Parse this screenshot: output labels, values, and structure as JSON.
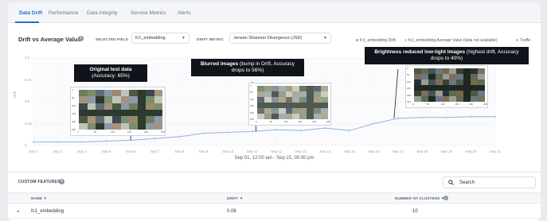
{
  "tabs": [
    {
      "label": "Data Drift",
      "active": true
    },
    {
      "label": "Performance",
      "active": false
    },
    {
      "label": "Data Integrity",
      "active": false
    },
    {
      "label": "Service Metrics",
      "active": false
    },
    {
      "label": "Alerts",
      "active": false
    }
  ],
  "chart_header": {
    "title": "Drift vs Average Value",
    "selected_field_label": "SELECTED FIELD",
    "selected_field_value": "fc1_embedding",
    "drift_metric_label": "DRIFT METRIC",
    "drift_metric_value": "Jensen Shannon Divergence (JSD)",
    "legend": [
      {
        "label": "fc1_embedding Drift",
        "color": "#7ea7dd"
      },
      {
        "label": "fc1_embedding Average Value (data not available)",
        "color": "#c9ced6"
      },
      {
        "label": "Traffic",
        "color": "#c7b4e6"
      }
    ]
  },
  "chart_data": {
    "type": "line",
    "ylabel": "Drift",
    "y_ticks": [
      "1.0",
      "0.75",
      "0.5",
      "0.25",
      "0"
    ],
    "ylim": [
      0,
      1
    ],
    "x_ticks": [
      "Sep 1",
      "Sep 3",
      "Sep 4",
      "Sep 5",
      "Sep 6",
      "Sep 7",
      "Sep 8",
      "Sep 9",
      "Sep 10",
      "Sep 11",
      "Sep 12",
      "Sep 13",
      "Sep 14",
      "Sep 15",
      "Sep 16",
      "Sep 17",
      "Sep 18",
      "Sep 19",
      "Sep 20",
      "Sep 21"
    ],
    "series": [
      {
        "name": "fc1_embedding Drift",
        "x": [
          0,
          1,
          2,
          3,
          4,
          5,
          6,
          7,
          8,
          9,
          10,
          11,
          12,
          13,
          14,
          15,
          16,
          17,
          18,
          19
        ],
        "values": [
          0.04,
          0.04,
          0.04,
          0.05,
          0.06,
          0.08,
          0.1,
          0.14,
          0.15,
          0.16,
          0.18,
          0.17,
          0.2,
          0.17,
          0.25,
          0.31,
          0.32,
          0.32,
          0.33,
          0.33
        ]
      }
    ],
    "grid": true
  },
  "annotations": [
    {
      "bold": "Original test data",
      "text": "(Accuracy: 65%)"
    },
    {
      "bold": "Blurred images",
      "text": " (bump in Drift, Accuracy drops to 56%)"
    },
    {
      "bold": "Brightness reduced low-light images",
      "text": " (highest drift, Accuracy drops to 40%)"
    }
  ],
  "image_grids": [
    {
      "x_ticks": [
        "0",
        "50",
        "100",
        "150",
        "200",
        "250"
      ],
      "y_ticks": [
        "0",
        "50",
        "100",
        "150",
        "200",
        "250"
      ],
      "palette": [
        "#6d7f5a",
        "#8a9aa6",
        "#4d5a3f",
        "#a6937c",
        "#5f6b74",
        "#c1c4b8",
        "#3d4550",
        "#7c8e6b",
        "#9b8a6e",
        "#2e3a2f"
      ]
    },
    {
      "x_ticks": [
        "0",
        "50",
        "100",
        "150",
        "200",
        "250"
      ],
      "y_ticks": [
        "0",
        "50",
        "100",
        "150",
        "200",
        "250"
      ],
      "palette": [
        "#7e8c78",
        "#a5aeb0",
        "#6a7565",
        "#b1a893",
        "#8b939a",
        "#c9ccc2",
        "#5e6670",
        "#95a087",
        "#a99d86",
        "#4f5a52"
      ]
    },
    {
      "x_ticks": [
        "0",
        "50",
        "100",
        "150",
        "200",
        "250"
      ],
      "y_ticks": [
        "0",
        "50",
        "100",
        "150",
        "200",
        "250"
      ],
      "palette": [
        "#4c5a44",
        "#6b7882",
        "#384230",
        "#7d6e5b",
        "#475159",
        "#9a9d92",
        "#2a3039",
        "#5c6c4e",
        "#76674f",
        "#1d2820"
      ]
    }
  ],
  "date_range": "Sep 01, 12:00 am - Sep 21, 05:00 pm",
  "features": {
    "title": "CUSTOM FEATURES",
    "search_placeholder": "Search",
    "columns": [
      "NAME ▼",
      "DRIFT ▼",
      "NUMBER OF CLUSTERS ▼"
    ],
    "rows": [
      {
        "name": "fc1_embedding",
        "drift": "0.06",
        "clusters": "10"
      }
    ]
  }
}
